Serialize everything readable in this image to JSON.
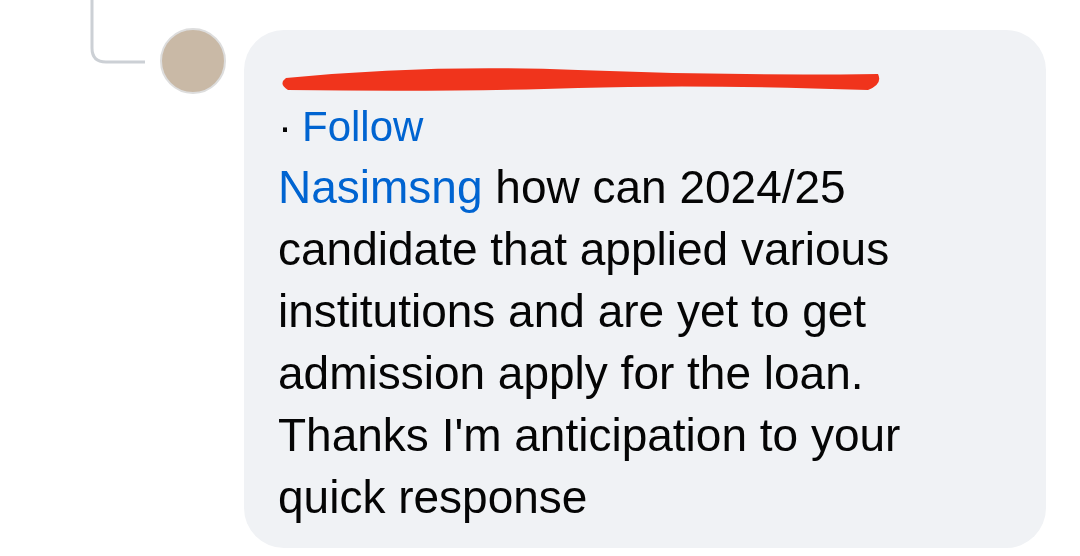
{
  "comment": {
    "redacted_name": true,
    "follow": "Follow",
    "separator": "·",
    "mention": "Nasimsng",
    "text": " how can 2024/25 candidate that applied various institutions and are yet to get admission apply for the loan. Thanks I'm anticipation to your quick response"
  }
}
